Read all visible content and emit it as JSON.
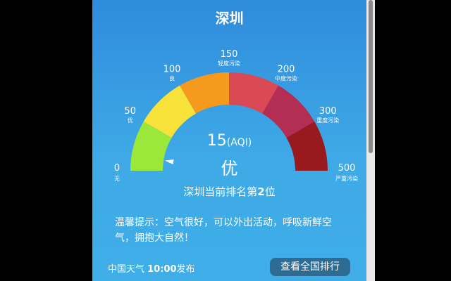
{
  "title": "深圳",
  "gauge": {
    "min": 0,
    "max": 500,
    "value": 15,
    "segments": [
      {
        "from": 0,
        "to": 50,
        "color": "#9be83a"
      },
      {
        "from": 50,
        "to": 100,
        "color": "#f7e23a"
      },
      {
        "from": 100,
        "to": 150,
        "color": "#f59a1c"
      },
      {
        "from": 150,
        "to": 200,
        "color": "#d94a55"
      },
      {
        "from": 200,
        "to": 300,
        "color": "#b42d52"
      },
      {
        "from": 300,
        "to": 500,
        "color": "#981a1f"
      }
    ],
    "ticks": [
      {
        "value": "0",
        "label": "无"
      },
      {
        "value": "50",
        "label": "优"
      },
      {
        "value": "100",
        "label": "良"
      },
      {
        "value": "150",
        "label": "轻度污染"
      },
      {
        "value": "200",
        "label": "中度污染"
      },
      {
        "value": "300",
        "label": "重度污染"
      },
      {
        "value": "500",
        "label": "严重污染"
      }
    ]
  },
  "aqi": {
    "value": "15",
    "unit": "(AQI)",
    "level": "优"
  },
  "rank": {
    "prefix": "深圳当前排名第",
    "number": "2",
    "suffix": "位"
  },
  "tip": "温馨提示：空气很好，可以外出活动，呼吸新鲜空气，拥抱大自然！",
  "footer": {
    "source": "中国天气 ",
    "time": "10:00",
    "suffix": "发布"
  },
  "rank_button": "查看全国排行"
}
